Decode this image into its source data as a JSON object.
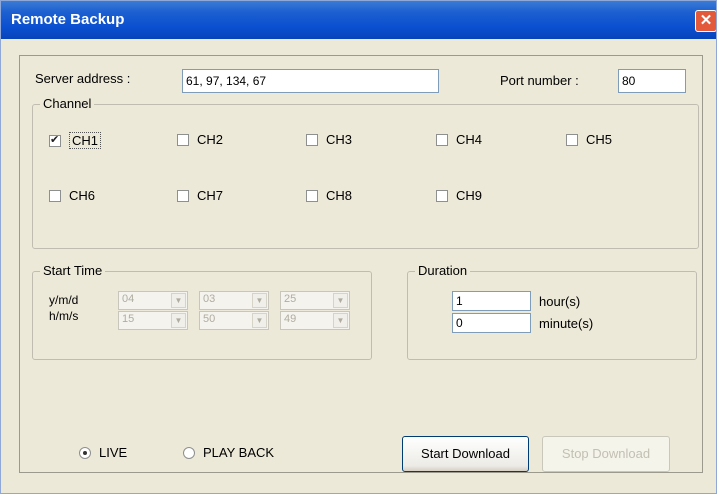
{
  "window": {
    "title": "Remote Backup",
    "close_label": "✕"
  },
  "server": {
    "label": "Server address :",
    "value": "61, 97, 134, 67"
  },
  "port": {
    "label": "Port number :",
    "value": "80"
  },
  "channel": {
    "legend": "Channel",
    "items": [
      {
        "label": "CH1",
        "checked": true
      },
      {
        "label": "CH2",
        "checked": false
      },
      {
        "label": "CH3",
        "checked": false
      },
      {
        "label": "CH4",
        "checked": false
      },
      {
        "label": "CH5",
        "checked": false
      },
      {
        "label": "CH6",
        "checked": false
      },
      {
        "label": "CH7",
        "checked": false
      },
      {
        "label": "CH8",
        "checked": false
      },
      {
        "label": "CH9",
        "checked": false
      }
    ]
  },
  "start_time": {
    "legend": "Start Time",
    "date_label": "y/m/d",
    "time_label": "h/m/s",
    "date_values": [
      "04",
      "03",
      "25"
    ],
    "time_values": [
      "15",
      "50",
      "49"
    ]
  },
  "duration": {
    "legend": "Duration",
    "hours_value": "1",
    "hours_unit": "hour(s)",
    "minutes_value": "0",
    "minutes_unit": "minute(s)"
  },
  "mode": {
    "live_label": "LIVE",
    "playback_label": "PLAY BACK",
    "selected": "live"
  },
  "buttons": {
    "start_label": "Start Download",
    "stop_label": "Stop Download"
  }
}
